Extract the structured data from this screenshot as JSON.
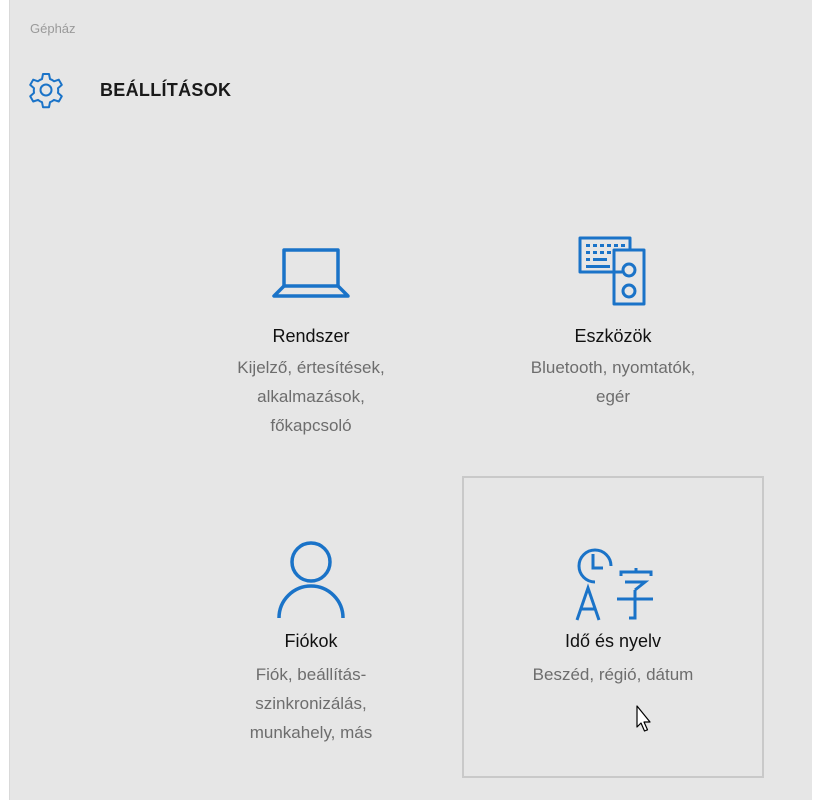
{
  "window": {
    "app_title": "Gépház"
  },
  "header": {
    "title": "BEÁLLÍTÁSOK",
    "icon": "gear-icon"
  },
  "colors": {
    "accent": "#1a73c8",
    "background": "#e6e6e6",
    "title_text": "#111111",
    "description_text": "#6d6d6d"
  },
  "tiles": [
    {
      "name": "Rendszer",
      "icon": "laptop-icon",
      "description": [
        "Kijelző, értesítések,",
        "alkalmazások,",
        "főkapcsoló"
      ]
    },
    {
      "name": "Eszközök",
      "icon": "devices-icon",
      "description": [
        "Bluetooth, nyomtatók,",
        "egér"
      ]
    },
    {
      "name": "Fiókok",
      "icon": "person-icon",
      "description": [
        "Fiók, beállítás-",
        "szinkronizálás,",
        "munkahely, más"
      ]
    },
    {
      "name": "Idő és nyelv",
      "icon": "time-language-icon",
      "description": [
        "Beszéd, régió, dátum"
      ],
      "hovered": true
    }
  ]
}
